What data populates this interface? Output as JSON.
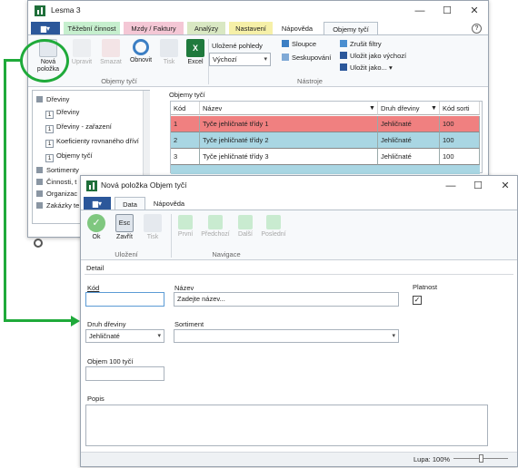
{
  "main_window": {
    "title": "Lesma 3",
    "tabs": [
      "Těžební činnost",
      "Mzdy / Faktury",
      "Analýzy",
      "Nastavení",
      "Nápověda",
      "Objemy tyčí"
    ],
    "tab_colors": [
      "#c6efce",
      "#f4c7d5",
      "#d9e8c3",
      "#f6f0a8",
      "#ffffff",
      "#ffffff"
    ],
    "ribbon": {
      "buttons": {
        "new": "Nová položka",
        "edit": "Upravit",
        "delete": "Smazat",
        "refresh": "Obnovit",
        "print": "Tisk",
        "excel": "Excel"
      },
      "group_label": "Objemy tyčí",
      "saved_views_label": "Uložené pohledy",
      "saved_views_value": "Výchozí",
      "columns": "Sloupce",
      "grouping": "Seskupování",
      "cancel_filters": "Zrušit filtry",
      "save_default": "Uložit jako výchozí",
      "save_as": "Uložit jako...",
      "tools_label": "Nástroje"
    },
    "tree": {
      "root": "Dřeviny",
      "children": [
        "Dřeviny",
        "Dřeviny - zařazení",
        "Koeficienty rovnaného dříví",
        "Objemy tyčí"
      ],
      "others": [
        "Sortimenty",
        "Činnosti, t",
        "Organizac",
        "Zakázky te"
      ]
    },
    "grid": {
      "title": "Objemy tyčí",
      "headers": [
        "Kód",
        "Název",
        "Druh dřeviny",
        "Kód sorti"
      ],
      "rows": [
        [
          "1",
          "Tyče jehličnaté třídy 1",
          "Jehličnaté",
          "100"
        ],
        [
          "2",
          "Tyče jehličnaté třídy 2",
          "Jehličnaté",
          "100"
        ],
        [
          "3",
          "Tyče jehličnaté třídy 3",
          "Jehličnaté",
          "100"
        ]
      ]
    }
  },
  "dialog": {
    "title": "Nová položka Objem tyčí",
    "tabs": [
      "Data",
      "Nápověda"
    ],
    "buttons": {
      "ok": "Ok",
      "esc_icon": "Esc",
      "close": "Zavřít",
      "print": "Tisk",
      "first": "První",
      "prev": "Předchozí",
      "next": "Další",
      "last": "Poslední"
    },
    "group_saving": "Uložení",
    "group_nav": "Navigace",
    "section": "Detail",
    "fields": {
      "code_label": "Kód",
      "name_label": "Název",
      "name_placeholder": "Zadejte název...",
      "validity_label": "Platnost",
      "wood_label": "Druh dřeviny",
      "wood_value": "Jehličnaté",
      "assortment_label": "Sortiment",
      "volume_label": "Objem 100 tyčí",
      "description_label": "Popis"
    },
    "zoom": "Lupa: 100%"
  },
  "colors": {
    "accent": "#2b579a",
    "highlight_green": "#1faa3a",
    "row_selected": "#f08080",
    "row_alt": "#a9d6e3"
  }
}
